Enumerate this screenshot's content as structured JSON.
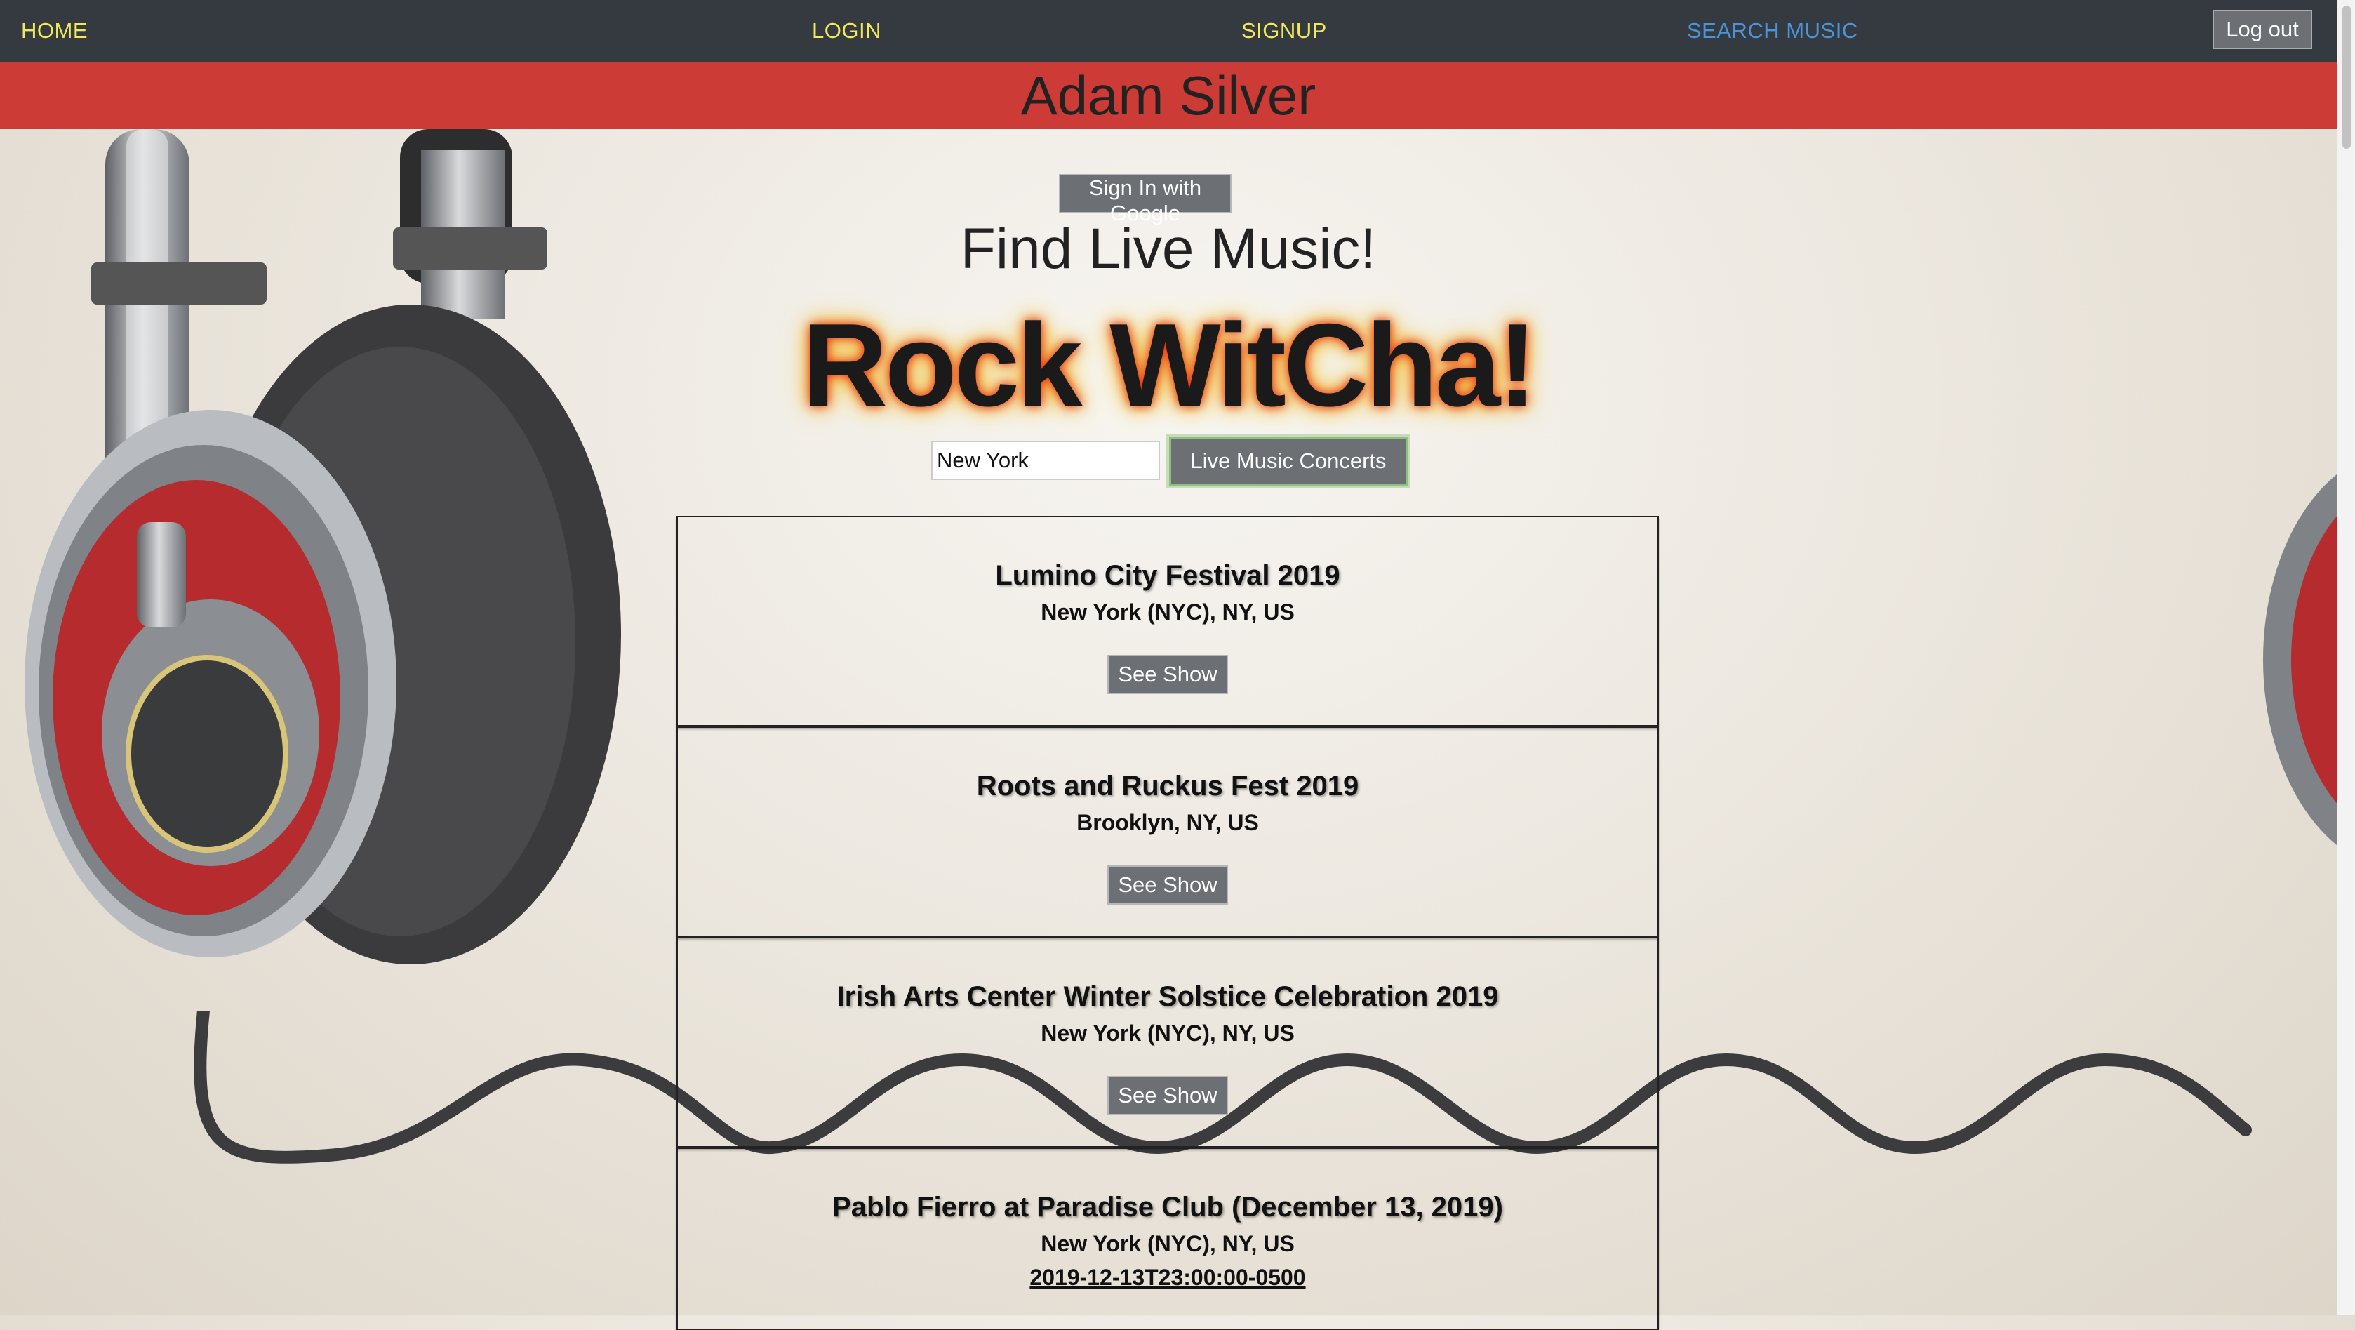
{
  "nav": {
    "home": "HOME",
    "login": "LOGIN",
    "signup": "SIGNUP",
    "search_music": "SEARCH MUSIC",
    "logout": "Log out"
  },
  "banner": {
    "user_name": "Adam Silver"
  },
  "auth": {
    "google_signin": "Sign In with Google"
  },
  "hero": {
    "title": "Find Live Music!",
    "brand": "Rock WitCha!"
  },
  "search": {
    "value": "New York",
    "button": "Live Music Concerts"
  },
  "events": [
    {
      "title": "Lumino City Festival 2019",
      "location": "New York (NYC), NY, US",
      "button": "See Show"
    },
    {
      "title": "Roots and Ruckus Fest 2019",
      "location": "Brooklyn, NY, US",
      "button": "See Show"
    },
    {
      "title": "Irish Arts Center Winter Solstice Celebration 2019",
      "location": "New York (NYC), NY, US",
      "button": "See Show"
    },
    {
      "title": "Pablo Fierro at Paradise Club (December 13, 2019)",
      "location": "New York (NYC), NY, US",
      "date": "2019-12-13T23:00:00-0500"
    }
  ],
  "colors": {
    "navbar": "#343a40",
    "nav_link": "#f2e85c",
    "nav_link_search": "#4b94d8",
    "banner": "#cc3b35",
    "button": "#6c6f73",
    "button_focus_ring": "#8dc07a"
  }
}
